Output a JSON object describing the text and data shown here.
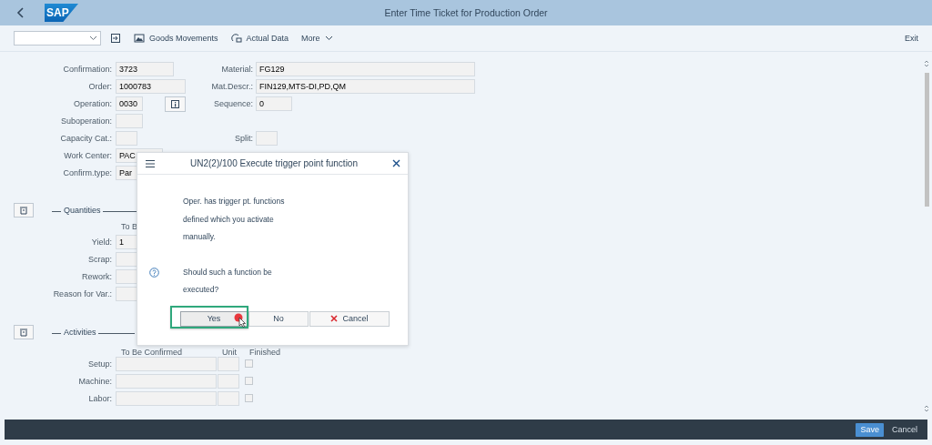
{
  "header": {
    "logo": "SAP",
    "title": "Enter Time Ticket for Production Order"
  },
  "toolbar": {
    "items": [
      {
        "kind": "dropdown"
      },
      {
        "kind": "icon"
      },
      {
        "kind": "icon-text",
        "label": "Goods Movements"
      },
      {
        "kind": "icon-text",
        "label": "Actual Data"
      },
      {
        "kind": "menu",
        "label": "More"
      }
    ],
    "exit": "Exit"
  },
  "general": [
    {
      "label": "Confirmation:",
      "value": "3723",
      "right": {
        "label": "Material:",
        "value": "FG129"
      }
    },
    {
      "label": "Order:",
      "value": "1000783",
      "right": {
        "label": "Mat.Descr.:",
        "value": "FIN129,MTS-DI,PD,QM"
      }
    },
    {
      "label": "Operation:",
      "value": "0030",
      "info_button": true,
      "right": {
        "label": "Sequence:",
        "value": "0"
      }
    },
    {
      "label": "Suboperation:"
    },
    {
      "label": "Capacity Cat.:",
      "right": {
        "label": "Split:"
      }
    },
    {
      "label": "Work Center:",
      "value": "PAC"
    },
    {
      "label": "Confirm.type:",
      "value": "Par"
    }
  ],
  "quantities": {
    "title": "Quantities",
    "columns": [
      "To B"
    ],
    "rows": [
      {
        "label": "Yield:",
        "value": "1"
      },
      {
        "label": "Scrap:"
      },
      {
        "label": "Rework:"
      },
      {
        "label": "Reason for Var.:"
      }
    ]
  },
  "activities": {
    "title": "Activities",
    "columns": [
      "To Be Confirmed",
      "Unit",
      "Finished"
    ],
    "rows": [
      {
        "label": "Setup:",
        "finished": false
      },
      {
        "label": "Machine:",
        "finished": false
      },
      {
        "label": "Labor:",
        "finished": false
      }
    ]
  },
  "dialog": {
    "title": "UN2(2)/100 Execute trigger point function",
    "message_lines": [
      "Oper. has trigger pt. functions",
      "defined which you activate",
      "manually."
    ],
    "question_lines": [
      "Should such a function be",
      "executed?"
    ],
    "buttons": [
      {
        "label": "Yes",
        "kind": "plain",
        "focused": true
      },
      {
        "label": "No",
        "kind": "plain",
        "focused": false
      },
      {
        "label": "Cancel",
        "kind": "cancel",
        "focused": false
      }
    ]
  },
  "footer": {
    "buttons": [
      {
        "label": "Save",
        "kind": "primary"
      },
      {
        "label": "Cancel",
        "kind": "plain"
      }
    ]
  }
}
